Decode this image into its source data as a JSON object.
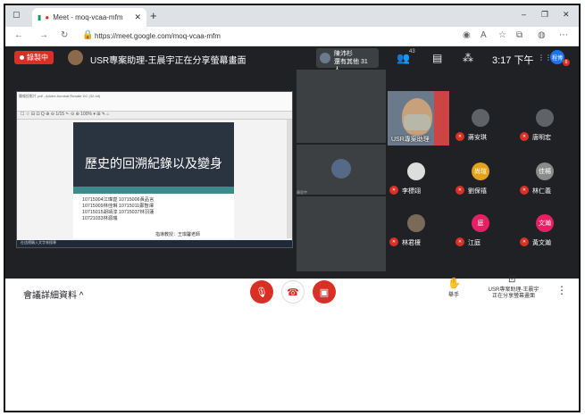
{
  "browser": {
    "tab_title": "Meet - moq-vcaa-mfm",
    "url": "https://meet.google.com/moq-vcaa-mfm",
    "min_glyph": "–",
    "max_glyph": "❐",
    "close_glyph": "✕",
    "new_tab_glyph": "+",
    "tab_close_glyph": "✕"
  },
  "meet": {
    "recording_label": "錄製中",
    "presenting_text": "USR專案助理-王晨宇正在分享螢幕畫面",
    "notice_line1": "陳沛杉",
    "notice_line2": "還有其他 31 人",
    "participant_badge": "43",
    "time": "3:17 下午",
    "self_initials": "程博",
    "self_badge": "6"
  },
  "presentation": {
    "window_title": "簡報投影片.pdf - Adobe Acrobat Reader DC (32-bit)",
    "tools": "☐ ☆ ⊟ ⊡ Q   ⊕ ⊖ 1/15   ⬑ ⊝ ⊕  100%  ▾  ⊞ ✎ ⌂",
    "slide_title": "歷史的回溯紀錄以及變身",
    "slide_lines": [
      "10715004江瑋崑 10715006黃品言",
      "10715009林佳琳 10715011鄭智澤",
      "10715015胡靖淳 10715037林羽蓮",
      "10721033林源瑞"
    ],
    "slide_guide": "指導教授：王琪馨老師",
    "taskbar_text": "在這裡輸入文字來搜尋"
  },
  "tiles": {
    "cam_name": "USR專案助理",
    "side_name": "陳思宇",
    "participants": [
      {
        "name": "蔣安琪",
        "initial": ""
      },
      {
        "name": "唐明宏",
        "initial": ""
      },
      {
        "name": "李標翊",
        "initial": ""
      },
      {
        "name": "劉保禧",
        "initial": "尚瑄"
      },
      {
        "name": "林仁義",
        "initial": "佳楊"
      },
      {
        "name": "林君榎",
        "initial": ""
      },
      {
        "name": "江庭",
        "initial": "庭"
      },
      {
        "name": "黃文瀚",
        "initial": "文瀚"
      }
    ]
  },
  "controls": {
    "details_label": "會議詳細資料",
    "raise_hand_label": "舉手",
    "presenting_label": "USR專案助理-王晨宇正在分享螢幕畫面",
    "more_glyph": "⋮"
  },
  "colors": {
    "red": "#d93025",
    "meet_bg": "#202124",
    "tile": "#3c4043",
    "accent": "#1a73e8"
  }
}
